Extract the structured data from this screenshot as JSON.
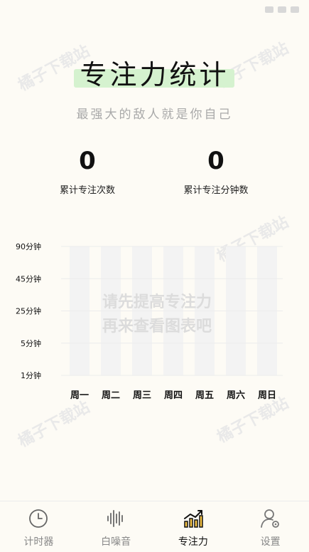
{
  "status_bar": {
    "time": "",
    "indicators": [
      "signal-icon",
      "wifi-icon",
      "battery-icon"
    ]
  },
  "header": {
    "title": "专注力统计",
    "subtitle": "最强大的敌人就是你自己"
  },
  "stats": [
    {
      "value": "0",
      "label": "累计专注次数"
    },
    {
      "value": "0",
      "label": "累计专注分钟数"
    }
  ],
  "empty_message": [
    "请先提高专注力",
    "再来查看图表吧"
  ],
  "watermark_text": "橘子下载站",
  "chart_data": {
    "type": "bar",
    "categories": [
      "周一",
      "周二",
      "周三",
      "周四",
      "周五",
      "周六",
      "周日"
    ],
    "values": [
      0,
      0,
      0,
      0,
      0,
      0,
      0
    ],
    "y_ticks": [
      "1分钟",
      "5分钟",
      "25分钟",
      "45分钟",
      "90分钟"
    ],
    "title": "",
    "xlabel": "",
    "ylabel": "",
    "grid": true
  },
  "tabs": [
    {
      "label": "计时器",
      "icon": "clock-icon",
      "active": false
    },
    {
      "label": "白噪音",
      "icon": "sound-wave-icon",
      "active": false
    },
    {
      "label": "专注力",
      "icon": "trend-chart-icon",
      "active": true
    },
    {
      "label": "设置",
      "icon": "user-settings-icon",
      "active": false
    }
  ],
  "colors": {
    "background": "#fdfbf5",
    "title_highlight": "#d5f2cf",
    "bar_placeholder": "#f3f3f3",
    "accent": "#f6c343"
  }
}
